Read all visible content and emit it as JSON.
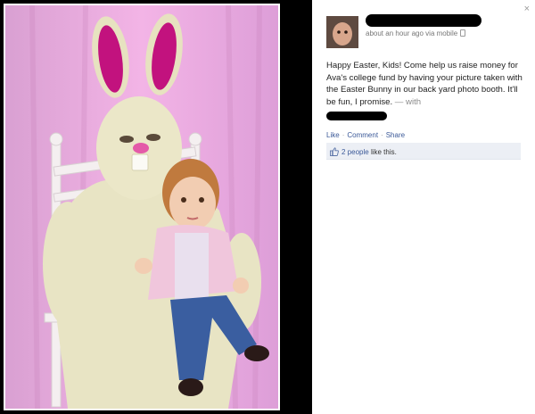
{
  "post": {
    "close_glyph": "×",
    "meta": "about an hour ago via mobile",
    "text": "Happy Easter, Kids! Come help us raise money for Ava's college fund by having your picture taken with the Easter Bunny in our back yard photo booth. It'll be fun, I promise.",
    "with_label": "— with",
    "actions": {
      "like": "Like",
      "separator": "·",
      "comment": "Comment",
      "share": "Share"
    },
    "likes": {
      "people_link": "2 people",
      "suffix": "like this."
    }
  },
  "icons": {
    "close": "close-icon",
    "mobile": "mobile-phone-icon",
    "like": "thumbs-up-icon"
  },
  "colors": {
    "link": "#3b5998",
    "likes_box_bg": "#eceff5",
    "backdrop": "#e79bd3",
    "redaction": "#000000"
  }
}
